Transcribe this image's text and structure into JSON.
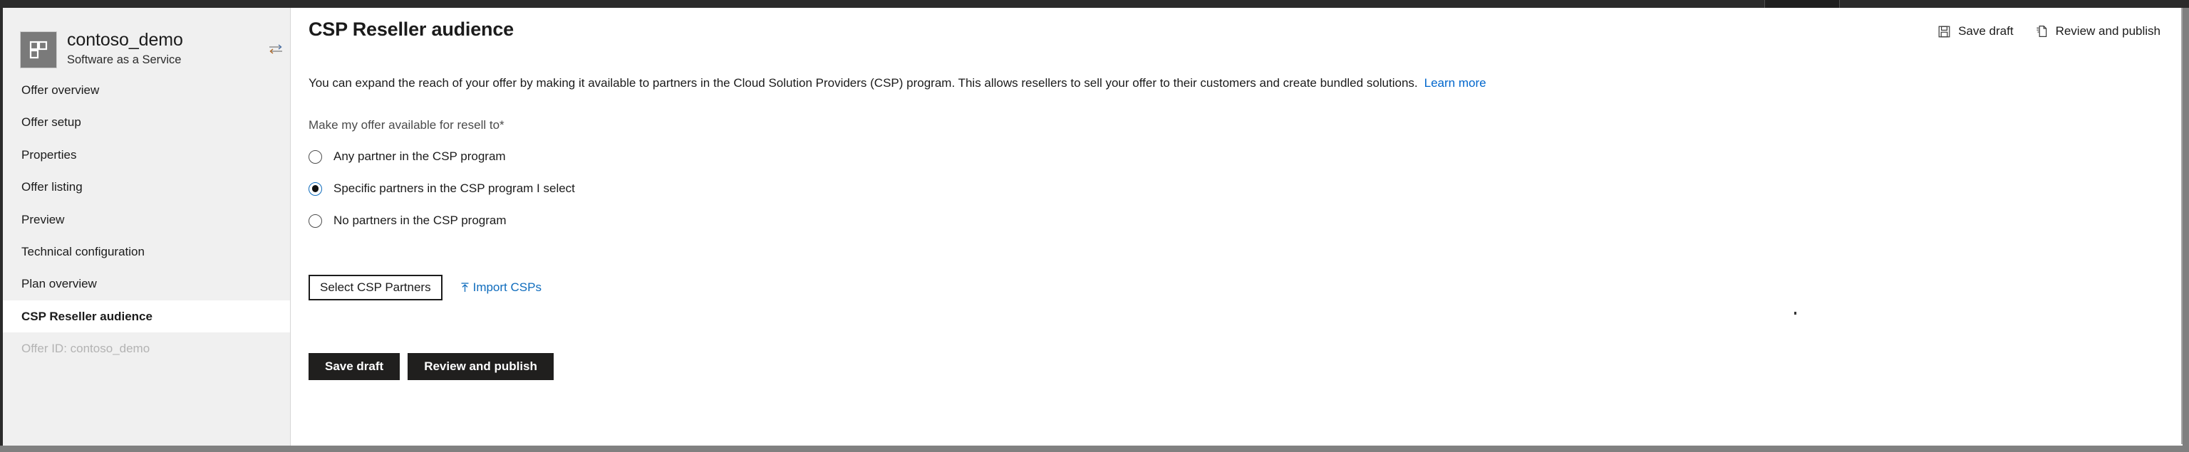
{
  "window": {
    "frame_color": "#2b2b2b",
    "border_color": "#808080"
  },
  "sidebar": {
    "offer": {
      "name": "contoso_demo",
      "type": "Software as a Service",
      "logo_icon": "blocks-logo-icon",
      "switch_icon": "swap-offer-icon"
    },
    "items": [
      {
        "label": "Offer overview",
        "selected": false,
        "muted": false
      },
      {
        "label": "Offer setup",
        "selected": false,
        "muted": false
      },
      {
        "label": "Properties",
        "selected": false,
        "muted": false
      },
      {
        "label": "Offer listing",
        "selected": false,
        "muted": false
      },
      {
        "label": "Preview",
        "selected": false,
        "muted": false
      },
      {
        "label": "Technical configuration",
        "selected": false,
        "muted": false
      },
      {
        "label": "Plan overview",
        "selected": false,
        "muted": false
      },
      {
        "label": "CSP Reseller audience",
        "selected": true,
        "muted": false
      },
      {
        "label": "Offer ID: contoso_demo",
        "selected": false,
        "muted": true
      }
    ]
  },
  "command_bar": {
    "save_draft": {
      "label": "Save draft",
      "icon": "save-disk-icon"
    },
    "review_publish": {
      "label": "Review and publish",
      "icon": "publish-page-icon"
    }
  },
  "main": {
    "title": "CSP Reseller audience",
    "intro_text": "You can expand the reach of your offer by making it available to partners in the Cloud Solution Providers (CSP) program. This allows resellers to sell your offer to their customers and create bundled solutions.",
    "intro_link": "Learn more",
    "field_label": "Make my offer available for resell to*",
    "radio_options": [
      {
        "label": "Any partner in the CSP program",
        "selected": false
      },
      {
        "label": "Specific partners in the CSP program I select",
        "selected": true
      },
      {
        "label": "No partners in the CSP program",
        "selected": false
      }
    ],
    "select_partners_button": "Select CSP Partners",
    "import_link": {
      "label": "Import CSPs",
      "icon": "upload-arrow-icon"
    },
    "footer_buttons": {
      "save_draft": "Save draft",
      "review_publish": "Review and publish"
    }
  },
  "colors": {
    "accent_blue": "#0f6cbd",
    "link_blue": "#0066cc",
    "dark_button": "#201f1e",
    "sidebar_bg": "#f0f0f0"
  }
}
